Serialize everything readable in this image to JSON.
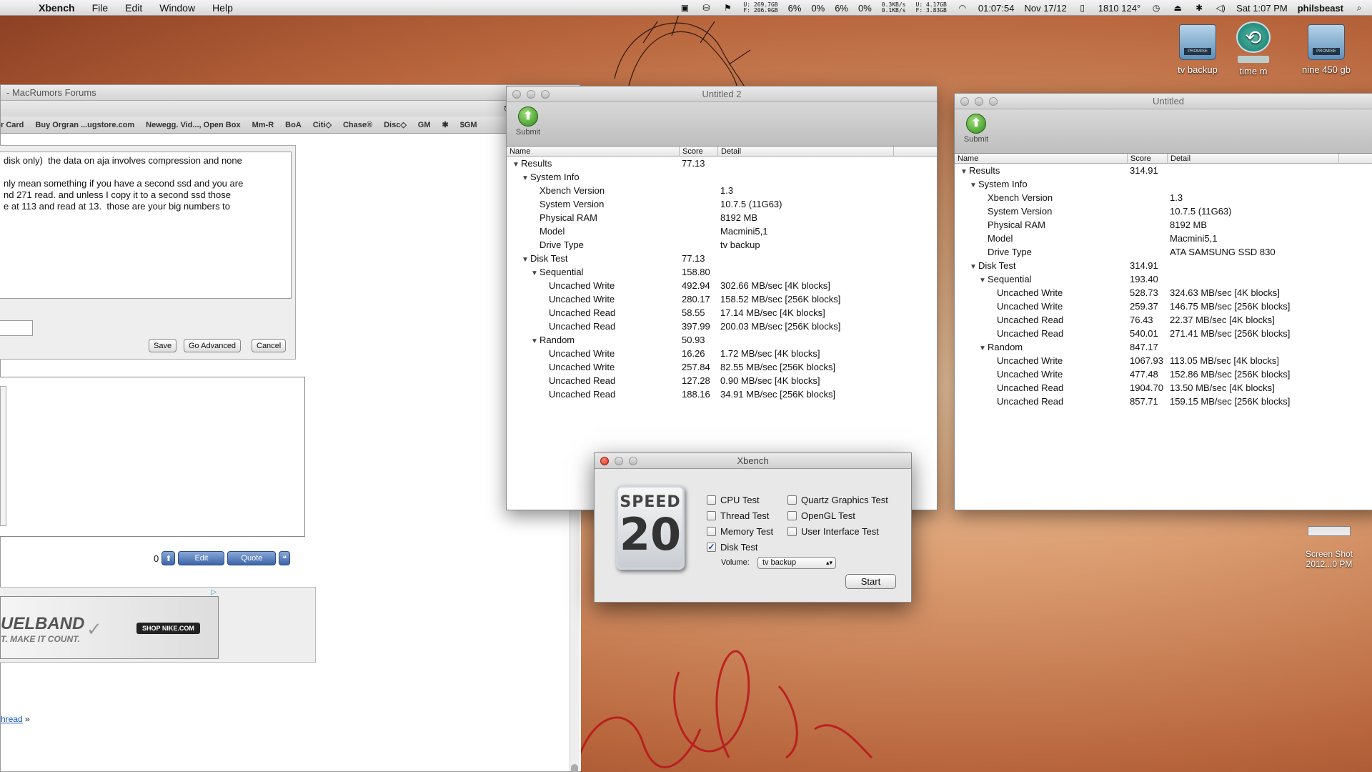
{
  "menubar": {
    "app": "Xbench",
    "menus": [
      "File",
      "Edit",
      "Window",
      "Help"
    ],
    "net_up": "U: 269.7GB",
    "net_free": "F: 206.9GB",
    "cpu": [
      "6%",
      "0%",
      "6%",
      "0%"
    ],
    "rate_up": "0.3KB/s",
    "rate_down": "0.1KB/s",
    "disk_u": "U: 4.17GB",
    "disk_f": "F: 3.83GB",
    "uptime": "01:07:54",
    "date": "Nov 17/12",
    "sensors": "1810 124°",
    "clock": "Sat 1:07 PM",
    "user": "philsbeast"
  },
  "desktop_icons": {
    "tv_backup": "tv backup",
    "time_machine": "time m",
    "nine": "nine 450 gb",
    "screenshot": "Screen Shot\n2012...0 PM",
    "drive_tag": "PROMISE"
  },
  "browser": {
    "title": "- MacRumors Forums",
    "bookmarks": [
      "r Card",
      "Buy Orgran ...ugstore.com",
      "Newegg. Vid..., Open Box",
      "Mm-R",
      "BoA",
      "Citi◇",
      "Chase®",
      "Disc◇",
      "GM",
      "✱",
      "$GM"
    ],
    "editor_text": "disk only)  the data on aja involves compression and none\n\nnly mean something if you have a second ssd and you are\nnd 271 read. and unless I copy it to a second ssd those\ne at 113 and read at 13.  those are your big numbers to",
    "save": "Save",
    "go_advanced": "Go Advanced",
    "cancel": "Cancel",
    "vote_count": "0",
    "edit": "Edit",
    "quote": "Quote",
    "ad_line1": "UELBAND",
    "ad_line2": "T. MAKE IT COUNT.",
    "ad_shop": "SHOP NIKE.COM",
    "thread_link": "hread",
    "thread_sep": "»"
  },
  "window2": {
    "title": "Untitled 2",
    "submit": "Submit",
    "headers": [
      "Name",
      "Score",
      "Detail"
    ],
    "rows": [
      {
        "name": "Results",
        "score": "77.13",
        "detail": "",
        "indent": 0,
        "tri": "▼"
      },
      {
        "name": "System Info",
        "score": "",
        "detail": "",
        "indent": 1,
        "tri": "▼"
      },
      {
        "name": "Xbench Version",
        "score": "",
        "detail": "1.3",
        "indent": 2,
        "tri": ""
      },
      {
        "name": "System Version",
        "score": "",
        "detail": "10.7.5 (11G63)",
        "indent": 2,
        "tri": ""
      },
      {
        "name": "Physical RAM",
        "score": "",
        "detail": "8192 MB",
        "indent": 2,
        "tri": ""
      },
      {
        "name": "Model",
        "score": "",
        "detail": "Macmini5,1",
        "indent": 2,
        "tri": ""
      },
      {
        "name": "Drive Type",
        "score": "",
        "detail": "tv backup",
        "indent": 2,
        "tri": ""
      },
      {
        "name": "Disk Test",
        "score": "77.13",
        "detail": "",
        "indent": 1,
        "tri": "▼"
      },
      {
        "name": "Sequential",
        "score": "158.80",
        "detail": "",
        "indent": 2,
        "tri": "▼"
      },
      {
        "name": "Uncached Write",
        "score": "492.94",
        "detail": "302.66 MB/sec [4K blocks]",
        "indent": 3,
        "tri": ""
      },
      {
        "name": "Uncached Write",
        "score": "280.17",
        "detail": "158.52 MB/sec [256K blocks]",
        "indent": 3,
        "tri": ""
      },
      {
        "name": "Uncached Read",
        "score": "58.55",
        "detail": "17.14 MB/sec [4K blocks]",
        "indent": 3,
        "tri": ""
      },
      {
        "name": "Uncached Read",
        "score": "397.99",
        "detail": "200.03 MB/sec [256K blocks]",
        "indent": 3,
        "tri": ""
      },
      {
        "name": "Random",
        "score": "50.93",
        "detail": "",
        "indent": 2,
        "tri": "▼"
      },
      {
        "name": "Uncached Write",
        "score": "16.26",
        "detail": "1.72 MB/sec [4K blocks]",
        "indent": 3,
        "tri": ""
      },
      {
        "name": "Uncached Write",
        "score": "257.84",
        "detail": "82.55 MB/sec [256K blocks]",
        "indent": 3,
        "tri": ""
      },
      {
        "name": "Uncached Read",
        "score": "127.28",
        "detail": "0.90 MB/sec [4K blocks]",
        "indent": 3,
        "tri": ""
      },
      {
        "name": "Uncached Read",
        "score": "188.16",
        "detail": "34.91 MB/sec [256K blocks]",
        "indent": 3,
        "tri": ""
      }
    ]
  },
  "window1": {
    "title": "Untitled",
    "submit": "Submit",
    "headers": [
      "Name",
      "Score",
      "Detail"
    ],
    "rows": [
      {
        "name": "Results",
        "score": "314.91",
        "detail": "",
        "indent": 0,
        "tri": "▼"
      },
      {
        "name": "System Info",
        "score": "",
        "detail": "",
        "indent": 1,
        "tri": "▼"
      },
      {
        "name": "Xbench Version",
        "score": "",
        "detail": "1.3",
        "indent": 2,
        "tri": ""
      },
      {
        "name": "System Version",
        "score": "",
        "detail": "10.7.5 (11G63)",
        "indent": 2,
        "tri": ""
      },
      {
        "name": "Physical RAM",
        "score": "",
        "detail": "8192 MB",
        "indent": 2,
        "tri": ""
      },
      {
        "name": "Model",
        "score": "",
        "detail": "Macmini5,1",
        "indent": 2,
        "tri": ""
      },
      {
        "name": "Drive Type",
        "score": "",
        "detail": "ATA SAMSUNG SSD 830",
        "indent": 2,
        "tri": ""
      },
      {
        "name": "Disk Test",
        "score": "314.91",
        "detail": "",
        "indent": 1,
        "tri": "▼"
      },
      {
        "name": "Sequential",
        "score": "193.40",
        "detail": "",
        "indent": 2,
        "tri": "▼"
      },
      {
        "name": "Uncached Write",
        "score": "528.73",
        "detail": "324.63 MB/sec [4K blocks]",
        "indent": 3,
        "tri": ""
      },
      {
        "name": "Uncached Write",
        "score": "259.37",
        "detail": "146.75 MB/sec [256K blocks]",
        "indent": 3,
        "tri": ""
      },
      {
        "name": "Uncached Read",
        "score": "76.43",
        "detail": "22.37 MB/sec [4K blocks]",
        "indent": 3,
        "tri": ""
      },
      {
        "name": "Uncached Read",
        "score": "540.01",
        "detail": "271.41 MB/sec [256K blocks]",
        "indent": 3,
        "tri": ""
      },
      {
        "name": "Random",
        "score": "847.17",
        "detail": "",
        "indent": 2,
        "tri": "▼"
      },
      {
        "name": "Uncached Write",
        "score": "1067.93",
        "detail": "113.05 MB/sec [4K blocks]",
        "indent": 3,
        "tri": ""
      },
      {
        "name": "Uncached Write",
        "score": "477.48",
        "detail": "152.86 MB/sec [256K blocks]",
        "indent": 3,
        "tri": ""
      },
      {
        "name": "Uncached Read",
        "score": "1904.70",
        "detail": "13.50 MB/sec [4K blocks]",
        "indent": 3,
        "tri": ""
      },
      {
        "name": "Uncached Read",
        "score": "857.71",
        "detail": "159.15 MB/sec [256K blocks]",
        "indent": 3,
        "tri": ""
      }
    ]
  },
  "xbench": {
    "title": "Xbench",
    "logo_top": "SPEED",
    "logo_num": "20",
    "tests": [
      {
        "label": "CPU Test",
        "checked": false
      },
      {
        "label": "Thread Test",
        "checked": false
      },
      {
        "label": "Memory Test",
        "checked": false
      },
      {
        "label": "Disk Test",
        "checked": true
      },
      {
        "label": "Quartz Graphics Test",
        "checked": false
      },
      {
        "label": "OpenGL Test",
        "checked": false
      },
      {
        "label": "User Interface Test",
        "checked": false
      }
    ],
    "volume_label": "Volume:",
    "volume_value": "tv backup",
    "start": "Start"
  }
}
